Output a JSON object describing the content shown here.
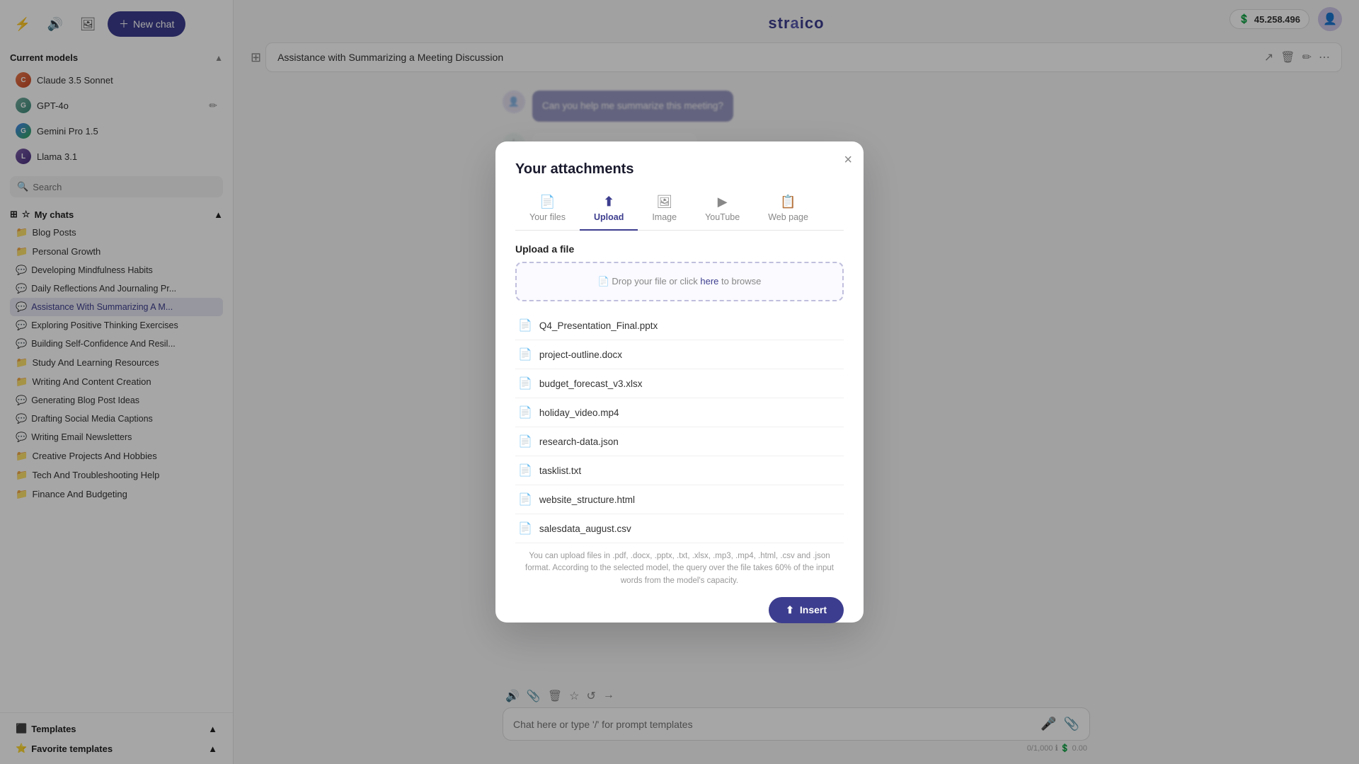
{
  "app": {
    "name": "straico",
    "balance": "45.258.496"
  },
  "sidebar": {
    "new_chat_label": "New chat",
    "current_models_label": "Current models",
    "my_chats_label": "My chats",
    "search_placeholder": "Search",
    "models": [
      {
        "name": "Claude 3.5 Sonnet",
        "type": "claude"
      },
      {
        "name": "GPT-4o",
        "type": "gpt"
      },
      {
        "name": "Gemini Pro 1.5",
        "type": "gemini"
      },
      {
        "name": "Llama 3.1",
        "type": "llama"
      }
    ],
    "folders": [
      {
        "name": "Blog Posts",
        "chats": []
      },
      {
        "name": "Personal Growth",
        "chats": [
          "Developing Mindfulness Habits",
          "Daily Reflections And Journaling Pr...",
          "Assistance With Summarizing A M...",
          "Exploring Positive Thinking Exercises",
          "Building Self-Confidence And Resil..."
        ]
      },
      {
        "name": "Study And Learning Resources",
        "chats": []
      },
      {
        "name": "Writing And Content Creation",
        "chats": [
          "Generating Blog Post Ideas",
          "Drafting Social Media Captions",
          "Writing Email Newsletters"
        ]
      },
      {
        "name": "Creative Projects And Hobbies",
        "chats": []
      },
      {
        "name": "Tech And Troubleshooting Help",
        "chats": []
      },
      {
        "name": "Finance And Budgeting",
        "chats": []
      }
    ],
    "active_chat": "Assistance With Summarizing A M...",
    "templates_label": "Templates",
    "favorite_templates_label": "Favorite templates"
  },
  "chat": {
    "title": "Assistance with Summarizing a Meeting Discussion",
    "input_placeholder": "Chat here or type '/' for prompt templates",
    "counter": "0/1,000"
  },
  "modal": {
    "title": "Your attachments",
    "close_label": "×",
    "tabs": [
      {
        "id": "your-files",
        "label": "Your files",
        "icon": "📄"
      },
      {
        "id": "upload",
        "label": "Upload",
        "icon": "⬆"
      },
      {
        "id": "image",
        "label": "Image",
        "icon": "🖼"
      },
      {
        "id": "youtube",
        "label": "YouTube",
        "icon": "▶"
      },
      {
        "id": "web-page",
        "label": "Web page",
        "icon": "📋"
      }
    ],
    "active_tab": "upload",
    "upload_section_label": "Upload a file",
    "drop_zone_text": "Drop your file or click ",
    "drop_zone_link": "here",
    "drop_zone_suffix": " to browse",
    "files": [
      {
        "name": "Q4_Presentation_Final.pptx"
      },
      {
        "name": "project-outline.docx"
      },
      {
        "name": "budget_forecast_v3.xlsx"
      },
      {
        "name": "holiday_video.mp4"
      },
      {
        "name": "research-data.json"
      },
      {
        "name": "tasklist.txt"
      },
      {
        "name": "website_structure.html"
      },
      {
        "name": "salesdata_august.csv"
      }
    ],
    "info_text": "You can upload files in .pdf, .docx, .pptx, .txt, .xlsx, .mp3, .mp4, .html, .csv and .json format. According to the selected model, the query over the file takes 60% of the input words from the model's capacity.",
    "insert_label": "Insert"
  }
}
